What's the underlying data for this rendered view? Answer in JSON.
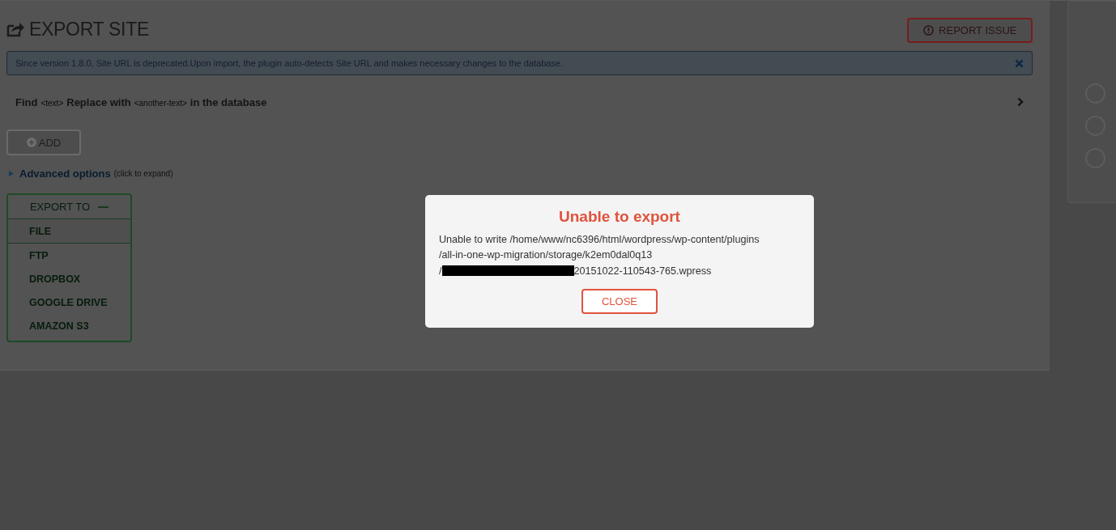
{
  "page": {
    "title": "EXPORT SITE",
    "report_button": "REPORT ISSUE"
  },
  "notice": {
    "text": "Since version 1.8.0, Site URL is deprecated.Upon import, the plugin auto-detects Site URL and makes necessary changes to the database.",
    "dismissible": true
  },
  "find_replace": {
    "expanded": false,
    "parts": [
      {
        "kind": "label",
        "text": "Find"
      },
      {
        "kind": "token",
        "text": "<text>"
      },
      {
        "kind": "label",
        "text": "Replace with"
      },
      {
        "kind": "token",
        "text": "<another-text>"
      },
      {
        "kind": "label",
        "text": "in the database"
      }
    ]
  },
  "add_button": {
    "label": "ADD",
    "disabled": true
  },
  "advanced_options": {
    "label": "Advanced options",
    "hint": "(click to expand)",
    "expanded": false
  },
  "export_menu": {
    "title": "EXPORT TO",
    "expanded": true,
    "items": [
      {
        "label": "FILE",
        "selected": true
      },
      {
        "label": "FTP",
        "selected": false
      },
      {
        "label": "DROPBOX",
        "selected": false
      },
      {
        "label": "GOOGLE DRIVE",
        "selected": false
      },
      {
        "label": "AMAZON S3",
        "selected": false
      }
    ]
  },
  "side_panel": {
    "options": [
      {
        "checked": false
      },
      {
        "checked": false
      },
      {
        "checked": false
      }
    ]
  },
  "dialog": {
    "title": "Unable to export",
    "lines": [
      {
        "parts": [
          {
            "kind": "text",
            "text": "Unable to write /home/www/nc6396/html/wordpress/wp-content/plugins"
          }
        ]
      },
      {
        "parts": [
          {
            "kind": "text",
            "text": "/all-in-one-wp-migration/storage/k2em0dal0q13"
          }
        ]
      },
      {
        "parts": [
          {
            "kind": "text",
            "text": "/"
          },
          {
            "kind": "redacted"
          },
          {
            "kind": "text",
            "text": "20151022-110543-765.wpress"
          }
        ]
      }
    ],
    "button": "CLOSE"
  }
}
